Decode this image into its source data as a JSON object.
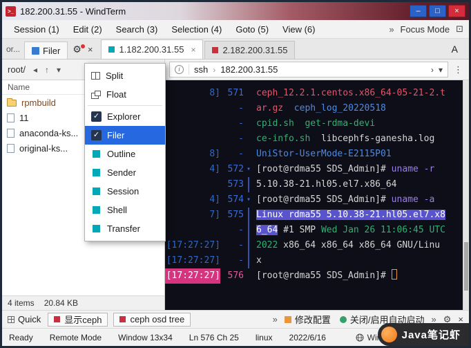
{
  "window": {
    "title": "182.200.31.55 - WindTerm",
    "app_glyph": ">_",
    "controls": {
      "minimize": "–",
      "maximize": "□",
      "close": "×"
    }
  },
  "icons": {
    "gear": "⚙",
    "close": "×",
    "kebab": "⋮",
    "overflow": "»",
    "chevron_down": "▾",
    "chevron_right": "›",
    "up": "↑",
    "back": "◂",
    "view": "▤",
    "info": "i",
    "focus_icon": "⊡",
    "check": "✓",
    "marker": "▾"
  },
  "menubar": {
    "items": [
      "Session (1)",
      "Edit (2)",
      "Search (3)",
      "Selection (4)",
      "Goto (5)",
      "View (6)"
    ],
    "overflow": "»",
    "focus_mode": "Focus Mode"
  },
  "tabrow": {
    "partial_tab": "or...",
    "filer_tab": "Filer",
    "font_button": "A",
    "session_tabs": [
      {
        "label": "1.182.200.31.55",
        "active": true,
        "icon_color": "#00a8b8",
        "closable": true
      },
      {
        "label": "2.182.200.31.55",
        "active": false,
        "icon_color": "#c8323c",
        "closable": false
      }
    ]
  },
  "pathbar": {
    "path": "root/"
  },
  "addressbar": {
    "protocol": "ssh",
    "host": "182.200.31.55"
  },
  "context_menu": {
    "selected_bg": "#2668e0",
    "accent": "#00a8b8",
    "items": [
      {
        "label": "Split",
        "type": "window",
        "icon": "split"
      },
      {
        "label": "Float",
        "type": "window",
        "icon": "float",
        "sep_after": true
      },
      {
        "label": "Explorer",
        "type": "checkbox",
        "checked": true
      },
      {
        "label": "Filer",
        "type": "checkbox",
        "checked": true,
        "selected": true
      },
      {
        "label": "Outline",
        "type": "pane"
      },
      {
        "label": "Sender",
        "type": "pane"
      },
      {
        "label": "Session",
        "type": "pane"
      },
      {
        "label": "Shell",
        "type": "pane"
      },
      {
        "label": "Transfer",
        "type": "pane"
      }
    ]
  },
  "filer": {
    "header": "Name",
    "items": [
      {
        "name": "rpmbuild",
        "type": "folder"
      },
      {
        "name": "11",
        "type": "file"
      },
      {
        "name": "anaconda-ks...",
        "type": "file"
      },
      {
        "name": "original-ks...",
        "type": "file"
      }
    ],
    "footer_count": "4 items",
    "footer_size": "20.84 KB"
  },
  "terminal": {
    "colors": {
      "background": "#0e0e18",
      "red": "#e4566a",
      "blue": "#4d8ae5",
      "green": "#2eb36e",
      "white": "#d6d6d6",
      "purple": "#9b7fe6",
      "selection": "#5a54cc",
      "gutter_blue": "#2d6ac8",
      "pink": "#d6347f",
      "cursor": "#e89a3c"
    },
    "rows": [
      {
        "ts": "8]",
        "num": "571",
        "segments": [
          {
            "t": "ceph_12.2.1.centos.x86_64-05-21-2.t",
            "c": "red"
          }
        ]
      },
      {
        "ts": "",
        "num": "-",
        "segments": [
          {
            "t": "ar.gz",
            "c": "red"
          },
          {
            "t": "  ",
            "c": "white"
          },
          {
            "t": "ceph_log_20220518",
            "c": "blue"
          }
        ]
      },
      {
        "ts": "",
        "num": "-",
        "segments": [
          {
            "t": "cpid.sh",
            "c": "green"
          },
          {
            "t": "  ",
            "c": "white"
          },
          {
            "t": "get-rdma-devi",
            "c": "green"
          }
        ]
      },
      {
        "ts": "",
        "num": "-",
        "segments": [
          {
            "t": "ce-info.sh",
            "c": "green"
          },
          {
            "t": "  ",
            "c": "white"
          },
          {
            "t": "libcephfs-ganesha.log",
            "c": "white"
          }
        ]
      },
      {
        "ts": "8]",
        "num": "-",
        "segments": [
          {
            "t": "UniStor-UserMode-E2115P01",
            "c": "blue"
          }
        ]
      },
      {
        "ts": "4]",
        "num": "572",
        "marker": true,
        "segments": [
          {
            "t": "[root@rdma55 SDS_Admin]# ",
            "c": "white"
          },
          {
            "t": "uname -r",
            "c": "purple"
          }
        ]
      },
      {
        "ts": "",
        "num": "573",
        "vline": true,
        "segments": [
          {
            "t": "5.10.38-21.hl05.el7.x86_64",
            "c": "white"
          }
        ]
      },
      {
        "ts": "4]",
        "num": "574",
        "marker": true,
        "segments": [
          {
            "t": "[root@rdma55 SDS_Admin]# ",
            "c": "white"
          },
          {
            "t": "uname -a",
            "c": "purple"
          }
        ]
      },
      {
        "ts": "7]",
        "num": "575",
        "vline": true,
        "segments": [
          {
            "t": "Linux rdma55 5.10.38-21.hl05.el7.x8",
            "c": "sel"
          }
        ]
      },
      {
        "ts": "",
        "num": "-",
        "vline": true,
        "segments": [
          {
            "t": "6_64",
            "c": "sel"
          },
          {
            "t": " #1 SMP ",
            "c": "white"
          },
          {
            "t": "Wed Jan 26 11:06:45 UTC",
            "c": "green"
          }
        ]
      },
      {
        "ts": "[17:27:27]",
        "num": "-",
        "vline": true,
        "segments": [
          {
            "t": "2022",
            "c": "green"
          },
          {
            "t": " x86_64 x86_64 x86_64 GNU/Linu",
            "c": "white"
          }
        ]
      },
      {
        "ts": "[17:27:27]",
        "num": "-",
        "vline": true,
        "segments": [
          {
            "t": "x",
            "c": "white"
          }
        ]
      },
      {
        "ts": "[17:27:27]",
        "ts_pink": true,
        "num": "576",
        "num_pink": true,
        "segments": [
          {
            "t": "[root@rdma55 SDS_Admin]# ",
            "c": "white"
          },
          {
            "t": "",
            "c": "cursor"
          }
        ]
      }
    ]
  },
  "toolbar": {
    "quick": "Quick",
    "overflow": "»",
    "buttons": [
      {
        "label": "显示ceph"
      },
      {
        "label": "ceph osd tree"
      }
    ],
    "right_buttons": [
      {
        "label": "修改配置",
        "icon": "edit"
      },
      {
        "label": "关闭/启用自动启动",
        "icon": "power"
      }
    ]
  },
  "statusbar": {
    "items": [
      "Ready",
      "Remote Mode",
      "Window 13x34",
      "Ln 576 Ch 25",
      "linux",
      "2022/6/16"
    ],
    "right_text": "Wind"
  },
  "watermark": {
    "text": "Java笔记虾"
  }
}
